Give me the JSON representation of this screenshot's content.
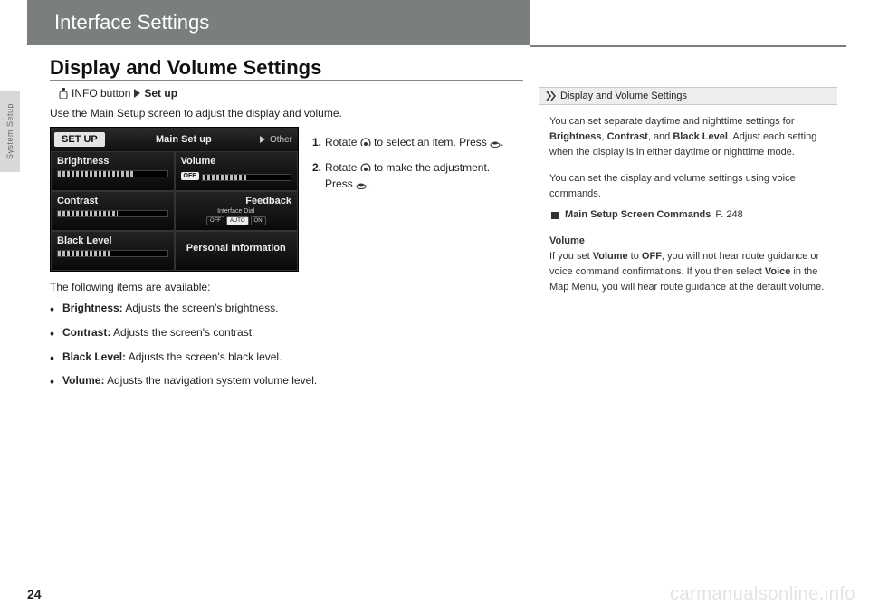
{
  "header": {
    "title": "Interface Settings"
  },
  "side_tab": "System Setup",
  "section": {
    "title": "Display and Volume Settings"
  },
  "breadcrumb": {
    "prefix": "INFO button",
    "target": "Set up"
  },
  "intro": "Use the Main Setup screen to adjust the display and volume.",
  "screenshot": {
    "setup_label": "SET UP",
    "main_label": "Main Set up",
    "other_label": "Other",
    "cells": {
      "brightness": "Brightness",
      "volume": "Volume",
      "volume_off": "OFF",
      "contrast": "Contrast",
      "feedback": "Feedback",
      "feedback_sub": "Interface Dial",
      "fb_off": "OFF",
      "fb_auto": "AUTO",
      "fb_on": "ON",
      "black_level": "Black Level",
      "personal": "Personal Information"
    }
  },
  "steps": [
    {
      "num": "1.",
      "text_a": "Rotate ",
      "text_b": " to select an item. Press ",
      "text_c": "."
    },
    {
      "num": "2.",
      "text_a": "Rotate ",
      "text_b": " to make the adjustment. Press ",
      "text_c": "."
    }
  ],
  "items_intro": "The following items are available:",
  "items": [
    {
      "b": "Brightness:",
      "t": " Adjusts the screen's brightness."
    },
    {
      "b": "Contrast:",
      "t": " Adjusts the screen's contrast."
    },
    {
      "b": "Black Level:",
      "t": " Adjusts the screen's black level."
    },
    {
      "b": "Volume:",
      "t": " Adjusts the navigation system volume level."
    }
  ],
  "sidebar": {
    "head": "Display and Volume Settings",
    "p1a": "You can set separate daytime and nighttime settings for ",
    "p1_b1": "Brightness",
    "p1_s1": ", ",
    "p1_b2": "Contrast",
    "p1_s2": ", and ",
    "p1_b3": "Black Level",
    "p1_s3": ". Adjust each setting when the display is in either daytime or nighttime mode.",
    "p2": "You can set the display and volume settings using voice commands.",
    "ref_b": "Main Setup Screen Commands",
    "ref_p": " P. 248",
    "p3_h": "Volume",
    "p3a": "If you set ",
    "p3_b1": "Volume",
    "p3_s1": " to ",
    "p3_b2": "OFF",
    "p3_s2": ", you will not hear route guidance or voice command confirmations. If you then select ",
    "p3_b3": "Voice",
    "p3_s3": " in the Map Menu, you will hear route guidance at the default volume."
  },
  "page_number": "24",
  "watermark": "carmanualsonline.info"
}
